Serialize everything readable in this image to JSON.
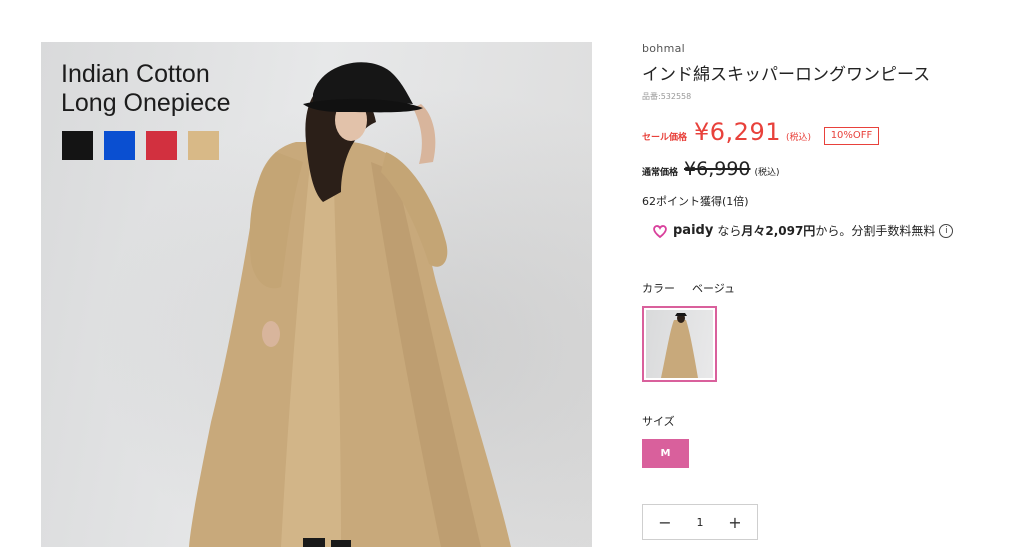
{
  "hero": {
    "title_line1": "Indian Cotton",
    "title_line2": "Long Onepiece",
    "swatch_colors": [
      "#141414",
      "#0a4fd1",
      "#d2303f",
      "#d8b987"
    ]
  },
  "product": {
    "brand": "bohmal",
    "title": "インド綿スキッパーロングワンピース",
    "sku": "品番:532558"
  },
  "price": {
    "sale_label": "セール価格",
    "sale_price": "¥6,291",
    "sale_tax": "(税込)",
    "discount_badge": "10%OFF",
    "regular_label": "通常価格",
    "regular_price": "¥6,990",
    "regular_tax": "(税込)",
    "points": "62ポイント獲得(1倍)"
  },
  "paidy": {
    "logo_text": "paidy",
    "text_before": "なら",
    "monthly": "月々2,097円",
    "text_after": "から。分割手数料無料",
    "info_icon": "i"
  },
  "color": {
    "label": "カラー",
    "selected": "ベージュ"
  },
  "size": {
    "label": "サイズ",
    "selected": "M"
  },
  "quantity": {
    "minus": "−",
    "value": "1",
    "plus": "+"
  },
  "colors": {
    "sale_red": "#e8413b",
    "accent_pink": "#d9609c"
  }
}
